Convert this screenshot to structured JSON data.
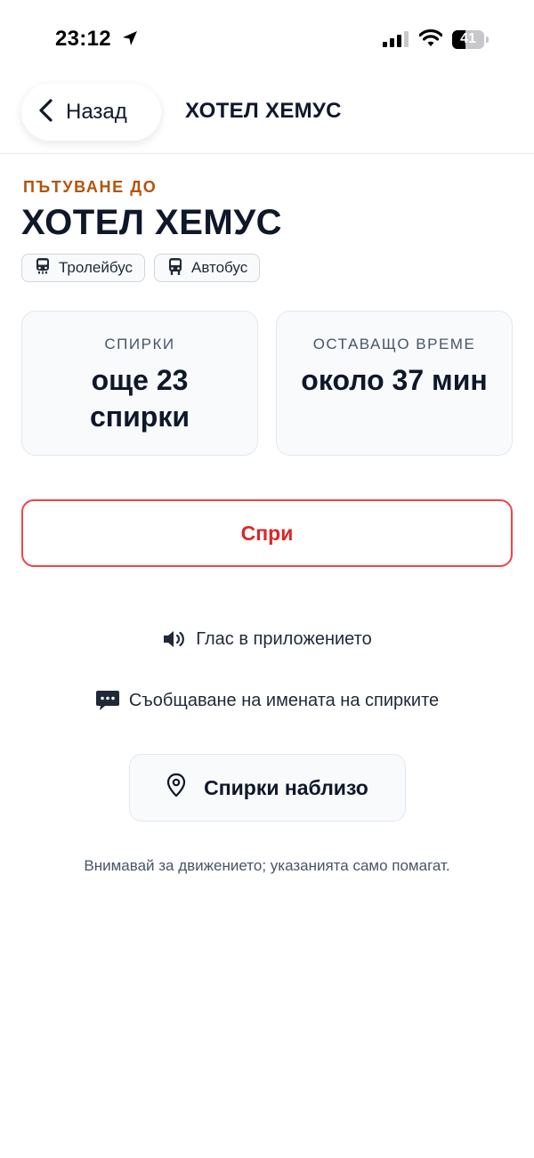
{
  "status_bar": {
    "time": "23:12",
    "battery_level": "41",
    "icons": [
      "location-arrow-icon",
      "cellular-signal-icon",
      "wifi-icon",
      "battery-icon"
    ]
  },
  "header": {
    "back_label": "Назад",
    "title": "ХОТЕЛ ХЕМУС"
  },
  "destination": {
    "eyebrow": "ПЪТУВАНЕ ДО",
    "name": "ХОТЕЛ ХЕМУС",
    "modes": [
      {
        "label": "Тролейбус",
        "icon": "trolleybus-icon"
      },
      {
        "label": "Автобус",
        "icon": "bus-icon"
      }
    ]
  },
  "stats": {
    "stops": {
      "caption": "СПИРКИ",
      "value": "още 23 спирки"
    },
    "time_left": {
      "caption": "ОСТАВАЩО ВРЕМЕ",
      "value": "около 37 мин"
    }
  },
  "actions": {
    "stop_label": "Спри",
    "voice_label": "Глас в приложението",
    "announce_label": "Съобщаване на имената на спирките",
    "nearby_label": "Спирки наблизо"
  },
  "footer_note": "Внимавай за движението; указанията само помагат.",
  "colors": {
    "accent_orange": "#b45309",
    "danger_red": "#ef4444",
    "text_dark": "#0f172a",
    "text_muted": "#475569",
    "card_bg": "#f8fafc"
  }
}
